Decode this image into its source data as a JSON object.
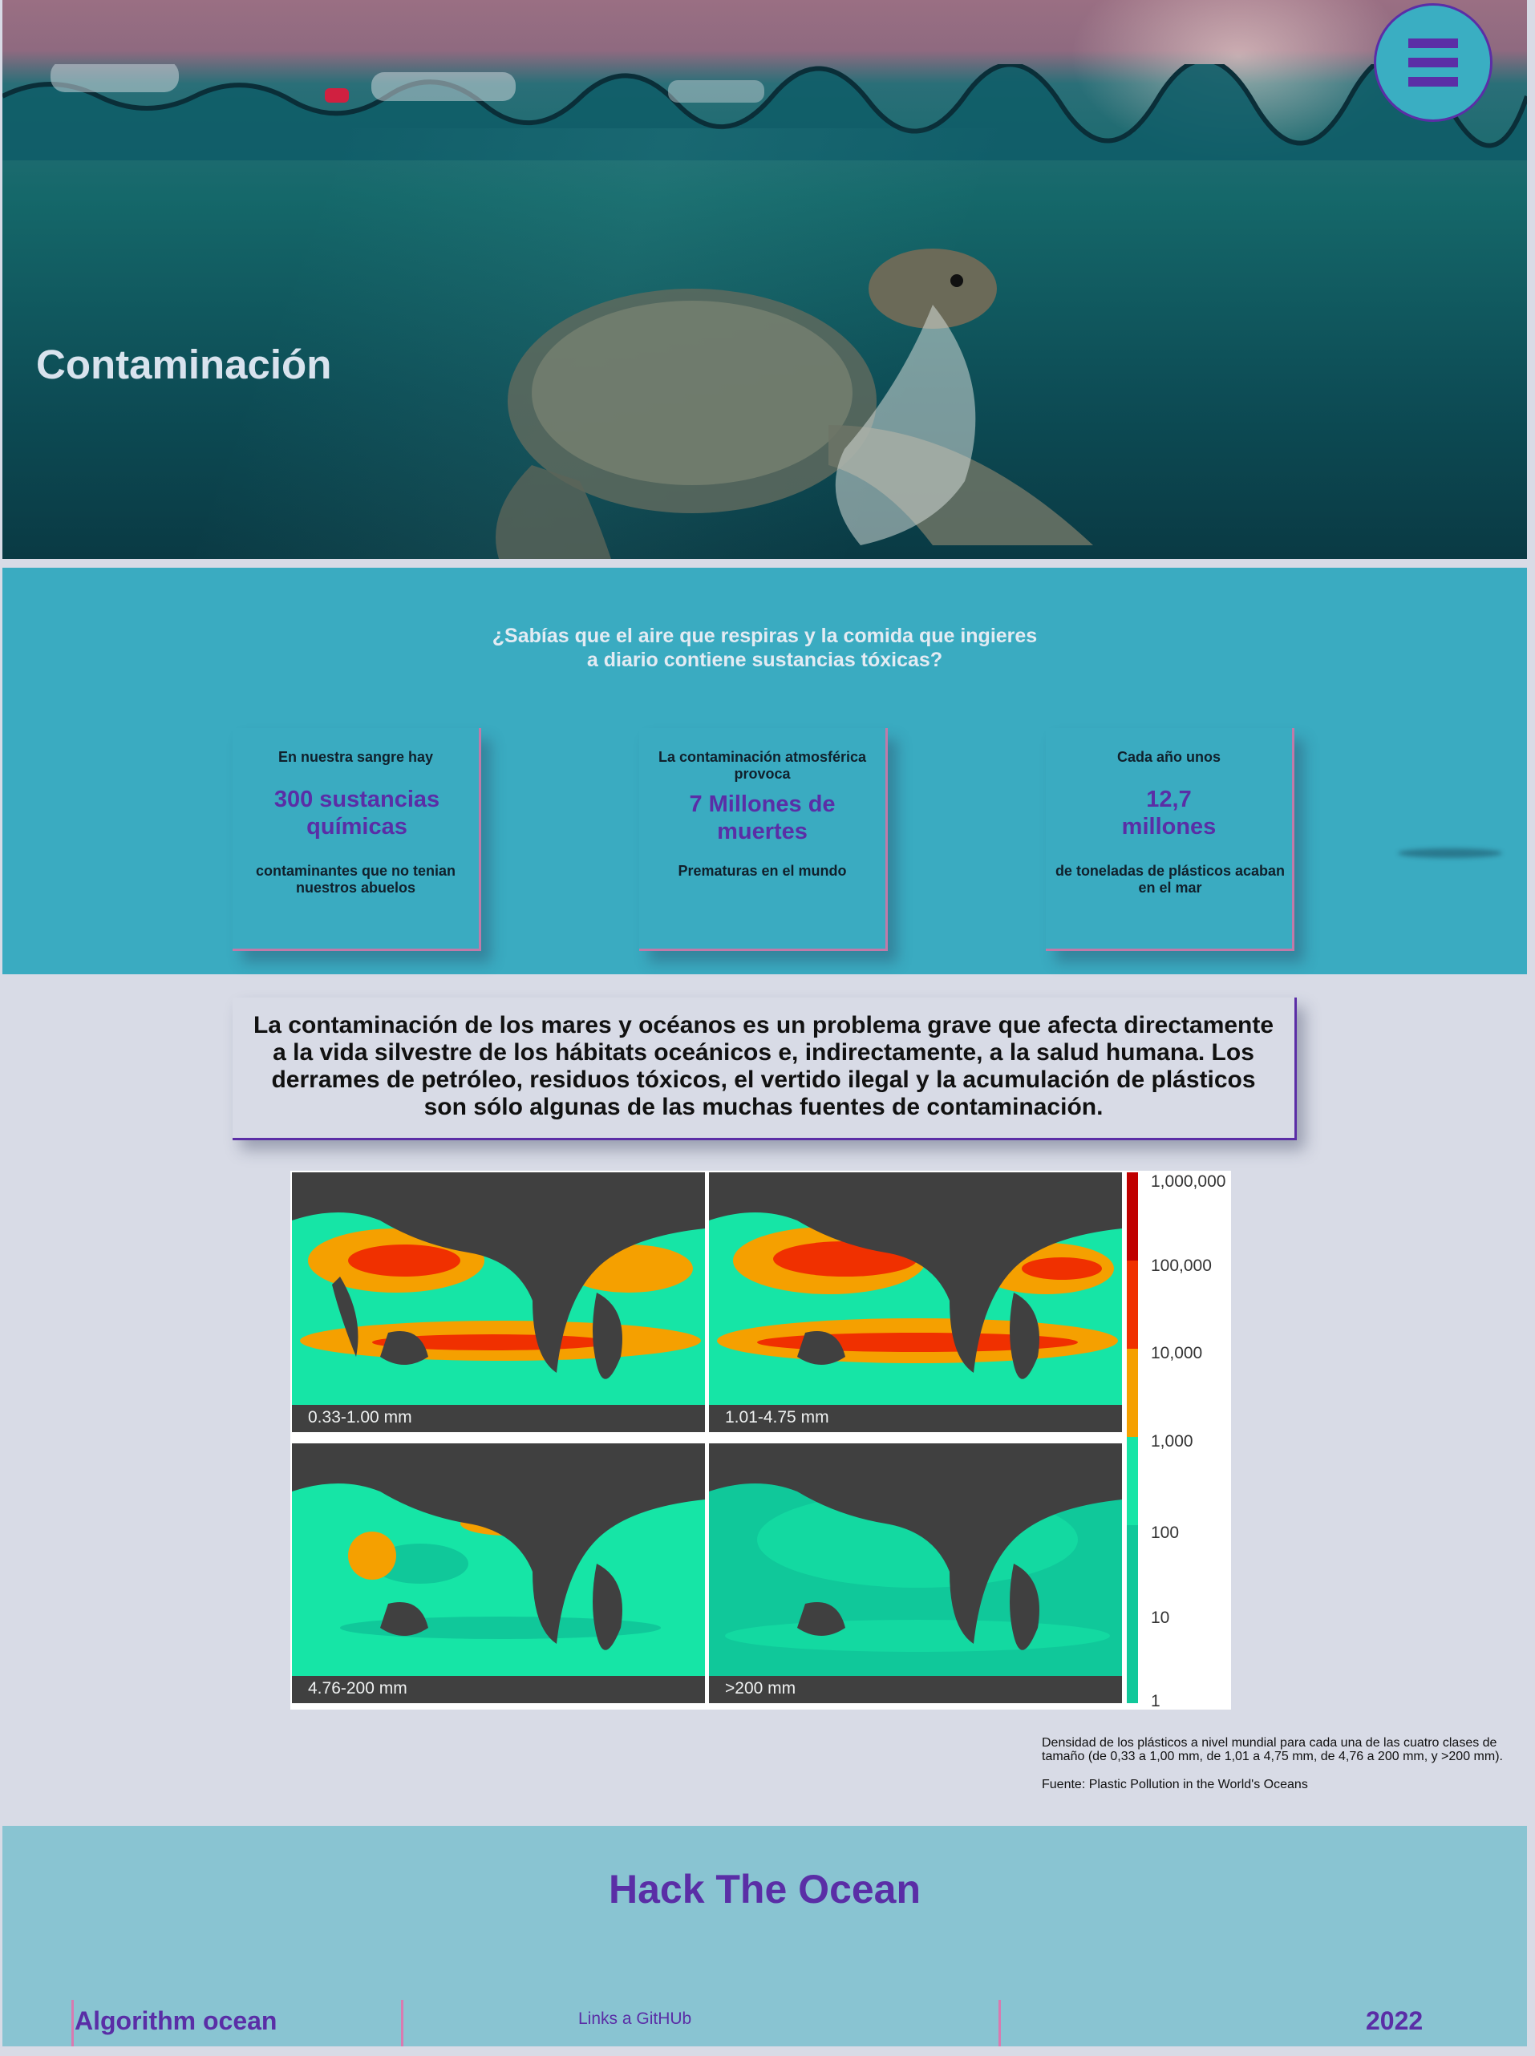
{
  "hero": {
    "title": "Contaminación",
    "menu_icon": "hamburger-menu-icon"
  },
  "facts": {
    "question": "¿Sabías que el aire que respiras y la comida que ingieres a diario contiene sustancias tóxicas?",
    "cards": [
      {
        "pre": "En nuestra sangre hay",
        "number": "300 sustancias químicas",
        "post": "contaminantes que no tenian nuestros abuelos"
      },
      {
        "pre": "La contaminación atmosférica provoca",
        "number": "7 Millones de muertes",
        "post": "Prematuras en el mundo"
      },
      {
        "pre": "Cada año unos",
        "number": "12,7 millones",
        "post": "de toneladas de plásticos acaban en el mar"
      }
    ]
  },
  "statement": "La contaminación de los mares y océanos es un problema grave que afecta directamente a la vida silvestre de los hábitats oceánicos e, indirectamente, a la salud humana. Los derrames de petróleo, residuos tóxicos, el vertido ilegal y la acumulación de plásticos son sólo algunas de las muchas fuentes de contaminación.",
  "figure": {
    "panels": [
      "0.33-1.00 mm",
      "1.01-4.75 mm",
      "4.76-200 mm",
      ">200 mm"
    ],
    "scale_ticks": [
      "1,000,000",
      "100,000",
      "10,000",
      "1,000",
      "100",
      "10",
      "1"
    ],
    "colors": {
      "land": "#404040",
      "low": "#16e5a6",
      "mid_low": "#10c89a",
      "orange": "#f5a000",
      "red": "#f03000",
      "dark_red": "#c00000"
    }
  },
  "caption": {
    "text": "Densidad de los plásticos a nivel mundial para cada una de las cuatro clases de tamaño (de 0,33 a 1,00 mm, de 1,01 a 4,75 mm, de 4,76 a 200 mm, y >200 mm).",
    "source": "Fuente: Plastic Pollution in the World's Oceans"
  },
  "footer": {
    "title": "Hack The Ocean",
    "team": "Algorithm ocean",
    "links": "Links a GitHUb",
    "year": "2022"
  },
  "colors": {
    "accent_purple": "#5a2ea6",
    "teal": "#3aabc1",
    "footer_bg": "#89c4d2",
    "page_bg": "#d8dbe6",
    "pink_border": "#c17aa8"
  }
}
